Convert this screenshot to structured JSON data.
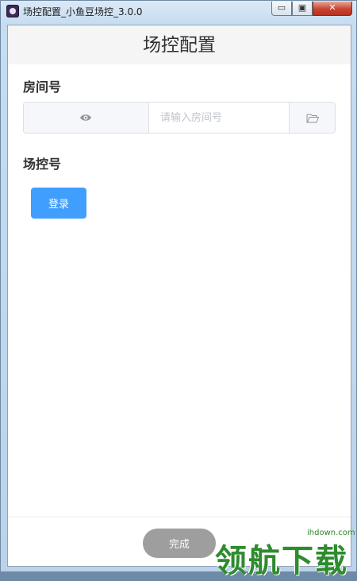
{
  "window": {
    "title": "场控配置_小鱼豆场控_3.0.0",
    "controls": {
      "minimize": "▭",
      "maximize": "▣",
      "close": "✕"
    }
  },
  "header": {
    "title": "场控配置"
  },
  "room": {
    "label": "房间号",
    "input_value": "",
    "placeholder": "请输入房间号",
    "prepend_icon": "eye-icon",
    "append_icon": "folder-open-icon"
  },
  "control": {
    "label": "场控号"
  },
  "buttons": {
    "login": "登录",
    "done": "完成"
  },
  "watermark": {
    "text": "领航下载",
    "url": "ihdown.com"
  },
  "colors": {
    "primary": "#409eff",
    "done_button": "#9e9e9e",
    "header_bg": "#f5f5f5"
  }
}
